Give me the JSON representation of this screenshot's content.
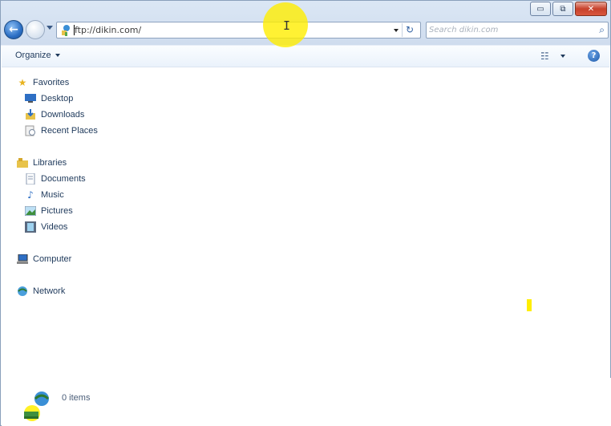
{
  "window": {
    "caption_buttons": {
      "minimize": "▭",
      "maximize": "⧉",
      "close": "✕"
    }
  },
  "address_bar": {
    "value": "ftp://dikin.com/",
    "site_icon": "ftp-site-icon"
  },
  "search": {
    "placeholder": "Search dikin.com"
  },
  "command_bar": {
    "organize_label": "Organize"
  },
  "nav_pane": {
    "favorites": {
      "label": "Favorites",
      "items": [
        {
          "label": "Desktop",
          "icon": "desktop-icon"
        },
        {
          "label": "Downloads",
          "icon": "downloads-icon"
        },
        {
          "label": "Recent Places",
          "icon": "recent-places-icon"
        }
      ]
    },
    "libraries": {
      "label": "Libraries",
      "items": [
        {
          "label": "Documents",
          "icon": "documents-icon"
        },
        {
          "label": "Music",
          "icon": "music-icon"
        },
        {
          "label": "Pictures",
          "icon": "pictures-icon"
        },
        {
          "label": "Videos",
          "icon": "videos-icon"
        }
      ]
    },
    "computer": {
      "label": "Computer"
    },
    "network": {
      "label": "Network"
    }
  },
  "status": {
    "item_count": "0 items"
  },
  "colors": {
    "accent": "#1e395b",
    "highlight": "#ffee00",
    "close_button": "#c7422c"
  }
}
